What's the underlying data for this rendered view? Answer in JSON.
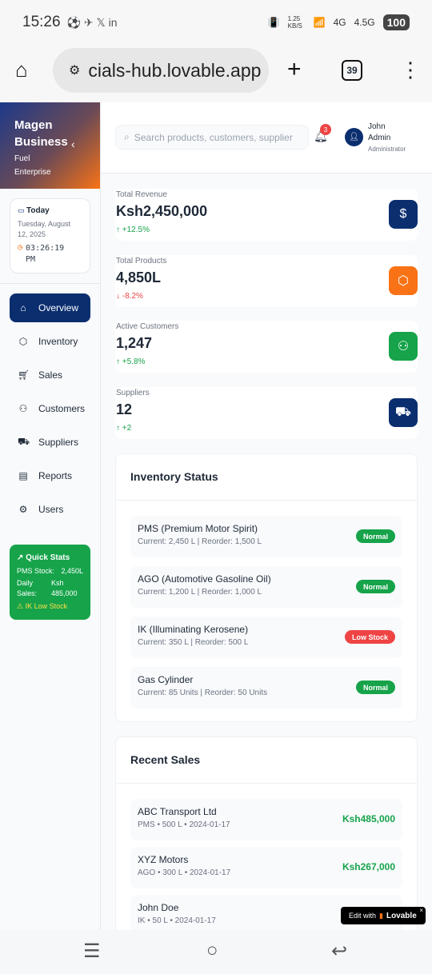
{
  "status_bar": {
    "time": "15:26",
    "net_speed": "1.25 KB/S",
    "net1": "4G",
    "net2": "4.5G",
    "battery": "100"
  },
  "browser": {
    "url": "cials-hub.lovable.app",
    "tab_count": "39"
  },
  "sidebar": {
    "brand_title": "Magen Business",
    "brand_subtitle": "Fuel Enterprise",
    "today_label": "Today",
    "date": "Tuesday, August 12, 2025",
    "time": "03:26:19 PM",
    "items": [
      {
        "label": "Overview",
        "icon": "home-icon"
      },
      {
        "label": "Inventory",
        "icon": "package-icon"
      },
      {
        "label": "Sales",
        "icon": "cart-icon"
      },
      {
        "label": "Customers",
        "icon": "users-icon"
      },
      {
        "label": "Suppliers",
        "icon": "truck-icon"
      },
      {
        "label": "Reports",
        "icon": "file-icon"
      },
      {
        "label": "Users",
        "icon": "gear-icon"
      }
    ],
    "quick_stats": {
      "title": "Quick Stats",
      "pms_label": "PMS Stock:",
      "pms_value": "2,450L",
      "sales_label": "Daily Sales:",
      "sales_value": "Ksh 485,000",
      "warning": "⚠ IK Low Stock"
    }
  },
  "header": {
    "search_placeholder": "Search products, customers, supplier",
    "notification_count": "3",
    "user_name": "John Admin",
    "user_role": "Administrator"
  },
  "stats": [
    {
      "label": "Total Revenue",
      "value": "Ksh2,450,000",
      "change": "↑ +12.5%",
      "trend": "up",
      "color": "#0b2e6f"
    },
    {
      "label": "Total Products",
      "value": "4,850L",
      "change": "↓ -8.2%",
      "trend": "down",
      "color": "#f97316"
    },
    {
      "label": "Active Customers",
      "value": "1,247",
      "change": "↑ +5.8%",
      "trend": "up",
      "color": "#16a34a"
    },
    {
      "label": "Suppliers",
      "value": "12",
      "change": "↑ +2",
      "trend": "up",
      "color": "#0b2e6f"
    }
  ],
  "inventory": {
    "title": "Inventory Status",
    "items": [
      {
        "name": "PMS (Premium Motor Spirit)",
        "detail": "Current: 2,450 L | Reorder: 1,500 L",
        "status": "Normal"
      },
      {
        "name": "AGO (Automotive Gasoline Oil)",
        "detail": "Current: 1,200 L | Reorder: 1,000 L",
        "status": "Normal"
      },
      {
        "name": "IK (Illuminating Kerosene)",
        "detail": "Current: 350 L | Reorder: 500 L",
        "status": "Low Stock"
      },
      {
        "name": "Gas Cylinder",
        "detail": "Current: 85 Units | Reorder: 50 Units",
        "status": "Normal"
      }
    ]
  },
  "sales": {
    "title": "Recent Sales",
    "items": [
      {
        "name": "ABC Transport Ltd",
        "detail": "PMS • 500 L • 2024-01-17",
        "amount": "Ksh485,000"
      },
      {
        "name": "XYZ Motors",
        "detail": "AGO • 300 L • 2024-01-17",
        "amount": "Ksh267,000"
      },
      {
        "name": "John Doe",
        "detail": "IK • 50 L • 2024-01-17",
        "amount": ""
      }
    ]
  },
  "lovable": {
    "prefix": "Edit with",
    "brand": "Lovable"
  }
}
